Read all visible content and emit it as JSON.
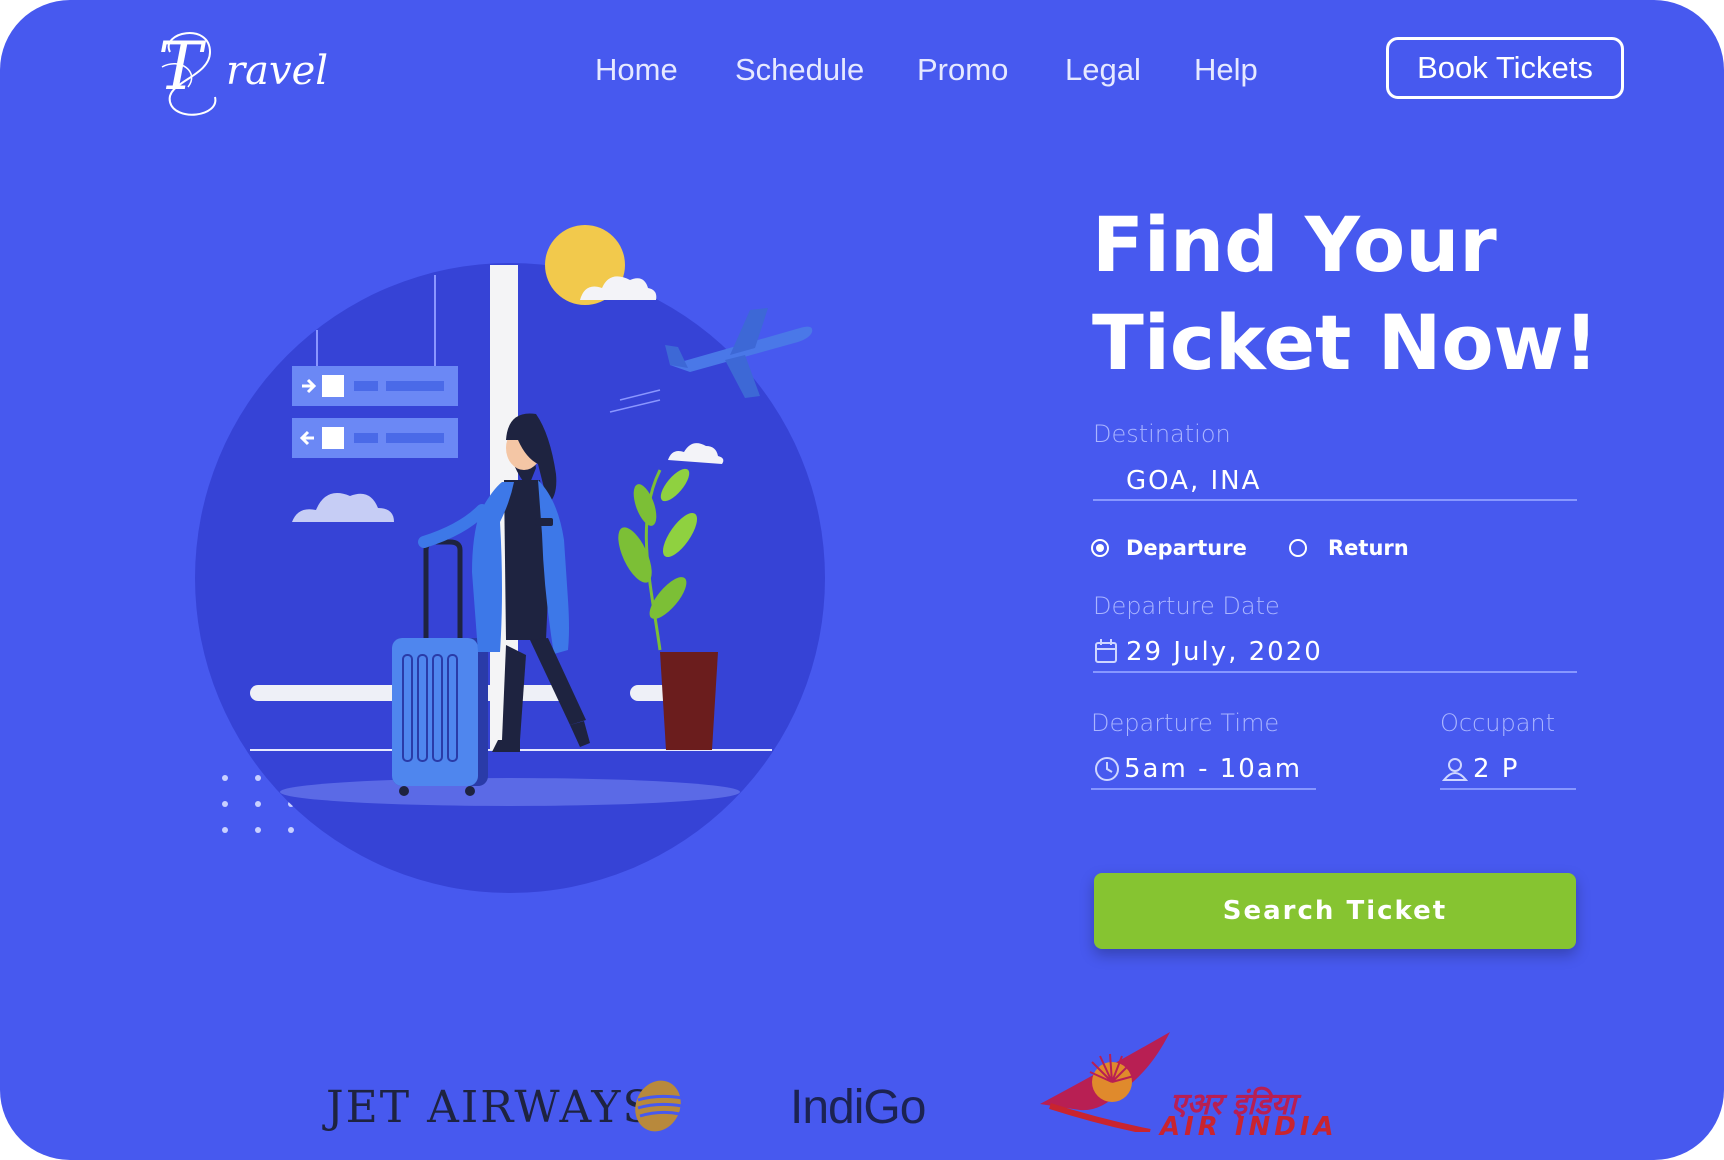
{
  "brand": {
    "logo_initial": "T",
    "logo_rest": "ravel"
  },
  "nav": {
    "items": [
      {
        "label": "Home"
      },
      {
        "label": "Schedule"
      },
      {
        "label": "Promo"
      },
      {
        "label": "Legal"
      },
      {
        "label": "Help"
      }
    ],
    "cta_label": "Book Tickets"
  },
  "hero": {
    "headline_line1": "Find Your",
    "headline_line2": "Ticket Now!"
  },
  "form": {
    "destination": {
      "label": "Destination",
      "value": "GOA, INA"
    },
    "trip_type": {
      "options": [
        {
          "label": "Departure",
          "selected": true
        },
        {
          "label": "Return",
          "selected": false
        }
      ]
    },
    "departure_date": {
      "label": "Departure Date",
      "value": "29 July, 2020"
    },
    "departure_time": {
      "label": "Departure Time",
      "value": "5am - 10am"
    },
    "occupant": {
      "label": "Occupant",
      "value": "2 P"
    },
    "submit_label": "Search Ticket"
  },
  "partners": {
    "jet": "JET AIRWAYS",
    "indigo": "IndiGo",
    "airindia_hindi": "एअर इंडिया",
    "airindia_english": "AIR INDIA"
  },
  "colors": {
    "background": "#4759ef",
    "button_green": "#86c431",
    "illustration_circle": "#3643d6",
    "plant_pot": "#6b1d1d",
    "sun": "#f2c94c"
  },
  "icons": [
    "calendar-icon",
    "clock-icon",
    "user-icon",
    "airplane-icon",
    "departure-sign-icon",
    "arrival-sign-icon"
  ]
}
